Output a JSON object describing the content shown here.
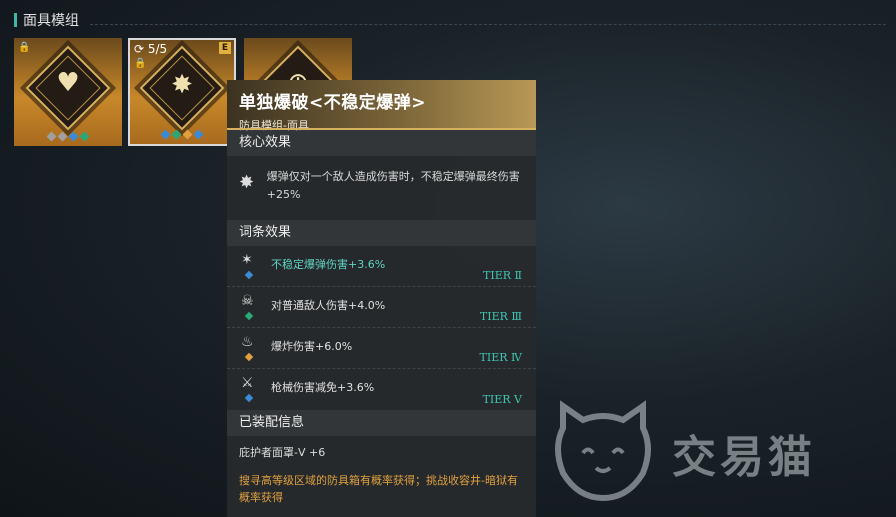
{
  "section": {
    "title": "面具模组"
  },
  "cards": [
    {
      "glyph": "♥",
      "gems": [
        "#a0a0a0",
        "#a0a0a0",
        "#3a8ad8",
        "#2ca878"
      ]
    },
    {
      "count": "5/5",
      "badge": "E",
      "glyph": "✸",
      "gems": [
        "#3a8ad8",
        "#2ca878",
        "#e0a040",
        "#3a8ad8"
      ]
    },
    {
      "glyph": "⊕",
      "gems": []
    }
  ],
  "tooltip": {
    "title": "单独爆破<不稳定爆弹>",
    "subtitle": "防具模组-面具",
    "core_title": "核心效果",
    "core_text": "爆弹仅对一个敌人造成伤害时，不稳定爆弹最终伤害+25%",
    "affix_title": "词条效果",
    "affixes": [
      {
        "text": "不稳定爆弹伤害+3.6%",
        "tier": "TIER Ⅱ",
        "gem": "#3a8ad8"
      },
      {
        "text": "对普通敌人伤害+4.0%",
        "tier": "TIER Ⅲ",
        "gem": "#2ca878"
      },
      {
        "text": "爆炸伤害+6.0%",
        "tier": "TIER Ⅳ",
        "gem": "#e0a040"
      },
      {
        "text": "枪械伤害减免+3.6%",
        "tier": "TIER Ⅴ",
        "gem": "#3a8ad8"
      }
    ],
    "equip_title": "已装配信息",
    "equip_text": "庇护者面罩-V +6",
    "source_text": "搜寻高等级区域的防具箱有概率获得；挑战收容井-暗狱有概率获得"
  },
  "watermark": {
    "text": "交易猫"
  },
  "colors": {
    "accent": "#3fb8a4",
    "tier": "#3fc4b0",
    "source": "#e0a040",
    "gold": "#d8b060"
  }
}
